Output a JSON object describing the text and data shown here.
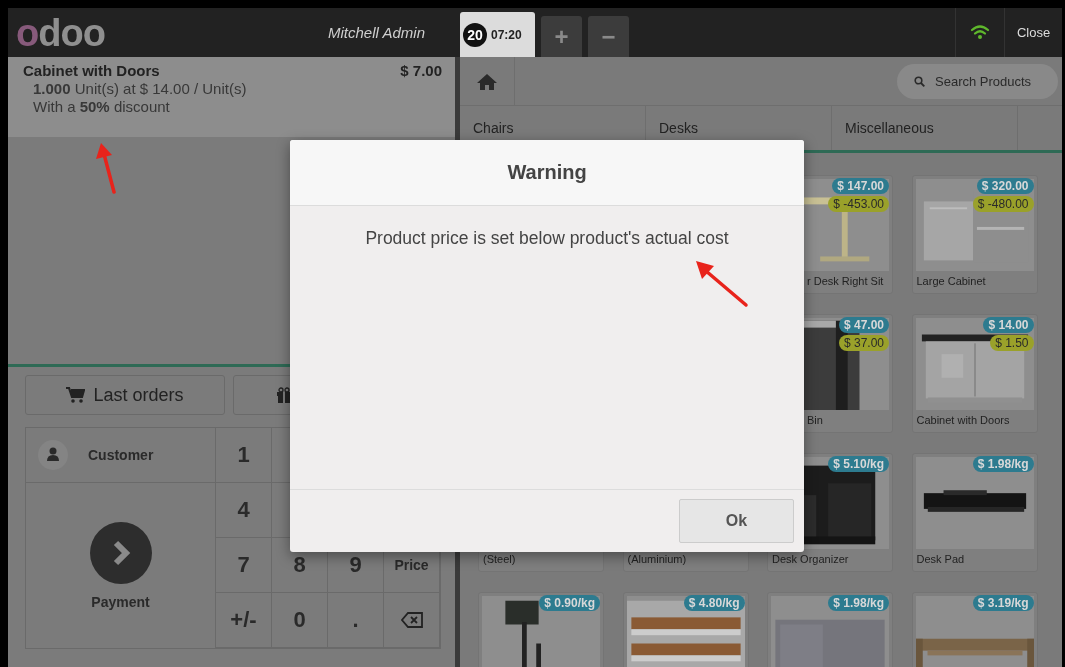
{
  "header": {
    "logo": "odoo",
    "user": "Mitchell Admin",
    "orders": [
      {
        "number": "20",
        "time": "07:20",
        "selected": true
      }
    ],
    "add_order": "+",
    "remove_order": "−",
    "close": "Close"
  },
  "order": {
    "lines": [
      {
        "product": "Cabinet with Doors",
        "price": "$ 7.00",
        "quantity": "**1.000** Unit(s) at $ 14.00 / Unit(s)",
        "discount": "With a **50%** discount",
        "selected": true
      }
    ]
  },
  "actions": [
    {
      "label": "Last orders"
    }
  ],
  "customer": "Customer",
  "payment": "Payment",
  "numpad": [
    [
      {
        "label": "1"
      }
    ],
    [
      {
        "label": "4"
      }
    ],
    [
      {
        "label": "7"
      },
      {
        "label": "8"
      },
      {
        "label": "9"
      },
      {
        "label": "Price"
      }
    ],
    [
      {
        "label": "+/-"
      },
      {
        "label": "0"
      },
      {
        "label": "."
      },
      {
        "kind": "backspace"
      }
    ]
  ],
  "search": {
    "placeholder": "Search Products"
  },
  "categories": [
    "Chairs",
    "Desks",
    "Miscellaneous"
  ],
  "product_rows": [
    [
      {
        "name": "r Desk Right Sit",
        "price": "$ 147.00",
        "cost": "$ -453.00",
        "kind": "picture"
      },
      {
        "name": "Large Cabinet",
        "price": "$ 320.00",
        "cost": "$ -480.00",
        "kind": "picture"
      }
    ],
    [
      {
        "name": "Bin",
        "price": "$ 47.00",
        "cost": "$ 37.00",
        "kind": "picture"
      },
      {
        "name": "Cabinet with Doors",
        "price": "$ 14.00",
        "cost": "$ 1.50",
        "kind": "picture"
      }
    ],
    [
      {
        "name": "(Steel)"
      },
      {
        "name": "(Aluminium)"
      },
      {
        "name": "Desk Organizer",
        "price": "$ 5.10/kg",
        "kind": "picture"
      },
      {
        "name": "Desk Pad",
        "price": "$ 1.98/kg",
        "kind": "picture"
      }
    ],
    [
      {
        "price": "$ 0.90/kg",
        "kind": "picture"
      },
      {
        "price": "$ 4.80/kg",
        "kind": "picture"
      },
      {
        "price": "$ 1.98/kg",
        "kind": "picture"
      },
      {
        "price": "$ 3.19/kg",
        "kind": "picture"
      }
    ]
  ],
  "dialog": {
    "title": "Warning",
    "message": "Product price is set below product's actual cost",
    "button": "Ok"
  }
}
